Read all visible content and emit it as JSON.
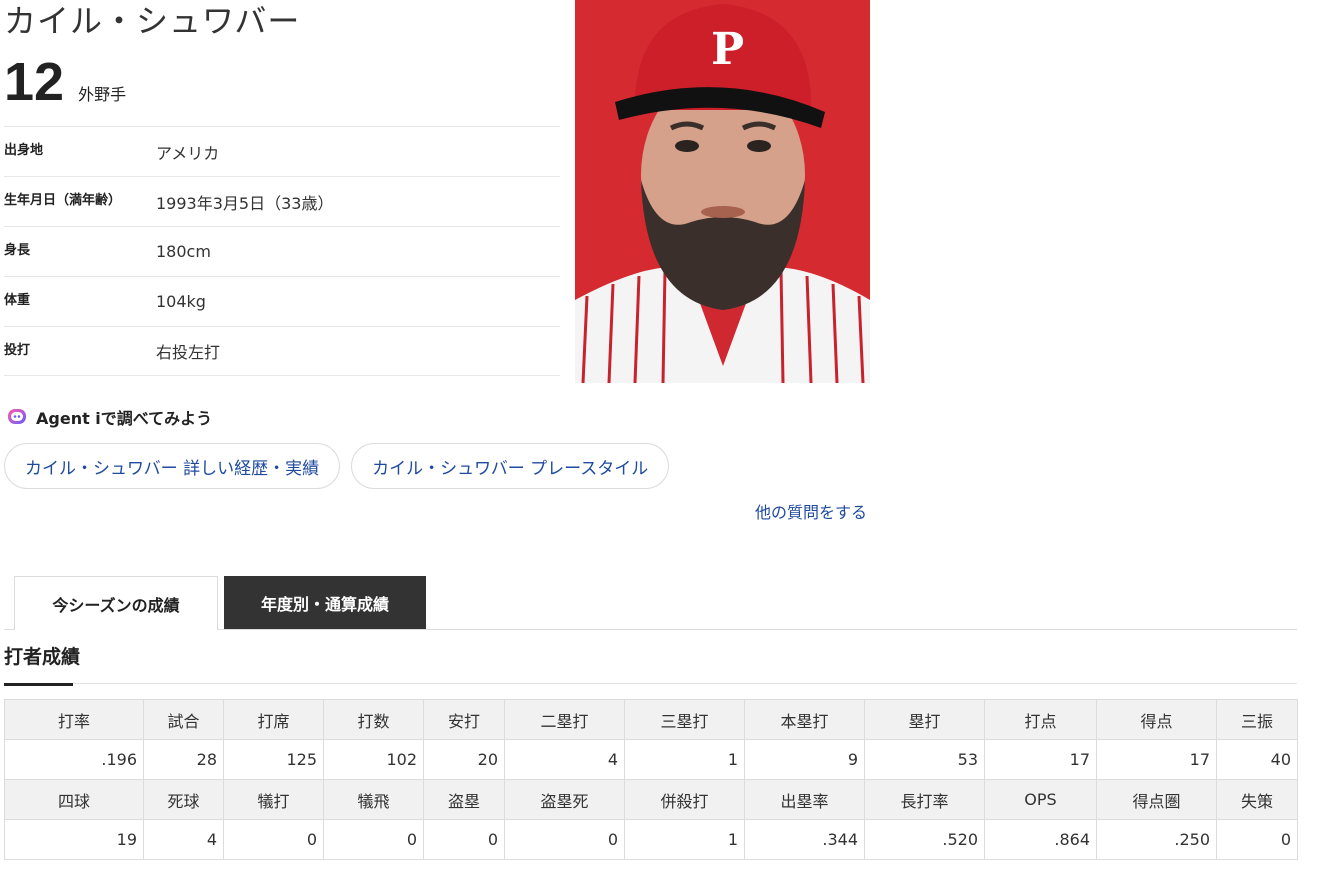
{
  "player": {
    "name": "カイル・シュワバー",
    "number": "12",
    "position": "外野手"
  },
  "profile": [
    {
      "label": "出身地",
      "value": "アメリカ"
    },
    {
      "label": "生年月日（満年齢）",
      "value": "1993年3月5日（33歳）"
    },
    {
      "label": "身長",
      "value": "180cm"
    },
    {
      "label": "体重",
      "value": "104kg"
    },
    {
      "label": "投打",
      "value": "右投左打"
    }
  ],
  "agent": {
    "title": "Agent iで調べてみよう",
    "chips": [
      "カイル・シュワバー 詳しい経歴・実績",
      "カイル・シュワバー プレースタイル"
    ],
    "more": "他の質問をする"
  },
  "tabs": {
    "active": "今シーズンの成績",
    "other": "年度別・通算成績"
  },
  "section": {
    "title": "打者成績"
  },
  "stats": {
    "row1_headers": [
      "打率",
      "試合",
      "打席",
      "打数",
      "安打",
      "二塁打",
      "三塁打",
      "本塁打",
      "塁打",
      "打点",
      "得点",
      "三振"
    ],
    "row1_values": [
      ".196",
      "28",
      "125",
      "102",
      "20",
      "4",
      "1",
      "9",
      "53",
      "17",
      "17",
      "40"
    ],
    "row2_headers": [
      "四球",
      "死球",
      "犠打",
      "犠飛",
      "盗塁",
      "盗塁死",
      "併殺打",
      "出塁率",
      "長打率",
      "OPS",
      "得点圏",
      "失策"
    ],
    "row2_values": [
      "19",
      "4",
      "0",
      "0",
      "0",
      "0",
      "1",
      ".344",
      ".520",
      ".864",
      ".250",
      "0"
    ]
  },
  "colors": {
    "link": "#1f4aa0",
    "tab_inactive_bg": "#333333",
    "photo_bg": "#d81f2a"
  }
}
